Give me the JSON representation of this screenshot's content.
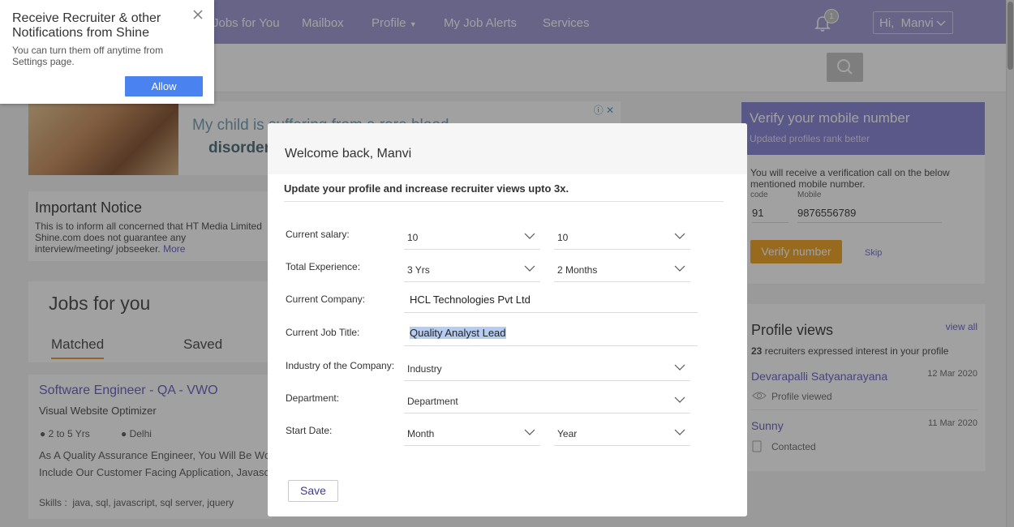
{
  "nav": {
    "items": [
      "Jobs for You",
      "Mailbox",
      "Profile",
      "My Job Alerts",
      "Services"
    ],
    "notification_count": "1",
    "user_greeting": "Hi,  Manvi"
  },
  "ad": {
    "line1": "My child is suffering from a rare blood",
    "line2": "disorder"
  },
  "notice": {
    "title": "Important Notice",
    "body": "This is to inform all concerned that HT Media Limited Shine.com does not guarantee any interview/meeting/ jobseeker.",
    "more": "More"
  },
  "jobs": {
    "title": "Jobs for you",
    "tabs": [
      "Matched",
      "Saved"
    ],
    "job": {
      "title": "Software Engineer - QA - VWO",
      "company": "Visual Website Optimizer",
      "experience": "2 to 5 Yrs",
      "location": "Delhi",
      "desc1": "As A Quality Assurance Engineer, You Will Be Wor",
      "desc2": "Include Our Customer Facing Application, Javasc",
      "skills": "Skills :  java, sql, javascript, sql server, jquery"
    }
  },
  "verify": {
    "title": "Verify your mobile number",
    "subtitle": "Updated profiles rank better",
    "info": "You will receive a verification call on the below mentioned mobile number.",
    "code_label": "code",
    "mobile_label": "Mobile",
    "code": "91",
    "mobile": "9876556789",
    "button": "Verify number",
    "skip": "Skip"
  },
  "profile_views": {
    "title": "Profile views",
    "view_all": "view all",
    "count": "23",
    "summary": "recruiters expressed interest in your profile",
    "entries": [
      {
        "name": "Devarapalli Satyanarayana",
        "date": "12 Mar 2020",
        "status": "Profile viewed"
      },
      {
        "name": "Sunny",
        "date": "11 Mar 2020",
        "status": "Contacted"
      }
    ]
  },
  "modal": {
    "title": "Welcome back, Manvi",
    "subtitle": "Update your profile and increase recruiter views upto 3x.",
    "labels": {
      "salary": "Current salary:",
      "experience": "Total Experience:",
      "company": "Current Company:",
      "job_title": "Current Job Title:",
      "industry": "Industry of the Company:",
      "department": "Department:",
      "start_date": "Start Date:"
    },
    "values": {
      "salary_lakh": "10",
      "salary_thousand": "10",
      "exp_years": "3 Yrs",
      "exp_months": "2 Months",
      "company": "HCL Technologies Pvt Ltd",
      "job_title": "Quality Analyst Lead",
      "industry": "Industry",
      "department": "Department",
      "start_month": "Month",
      "start_year": "Year"
    },
    "save": "Save"
  },
  "notification_popup": {
    "title": "Receive Recruiter & other Notifications from Shine",
    "body": "You can turn them off anytime from Settings page.",
    "allow": "Allow"
  },
  "colors": {
    "nav": "#a39fd6",
    "accent": "#6f6ac8",
    "verify_button": "#f0a830",
    "allow_button": "#4a82f0"
  }
}
